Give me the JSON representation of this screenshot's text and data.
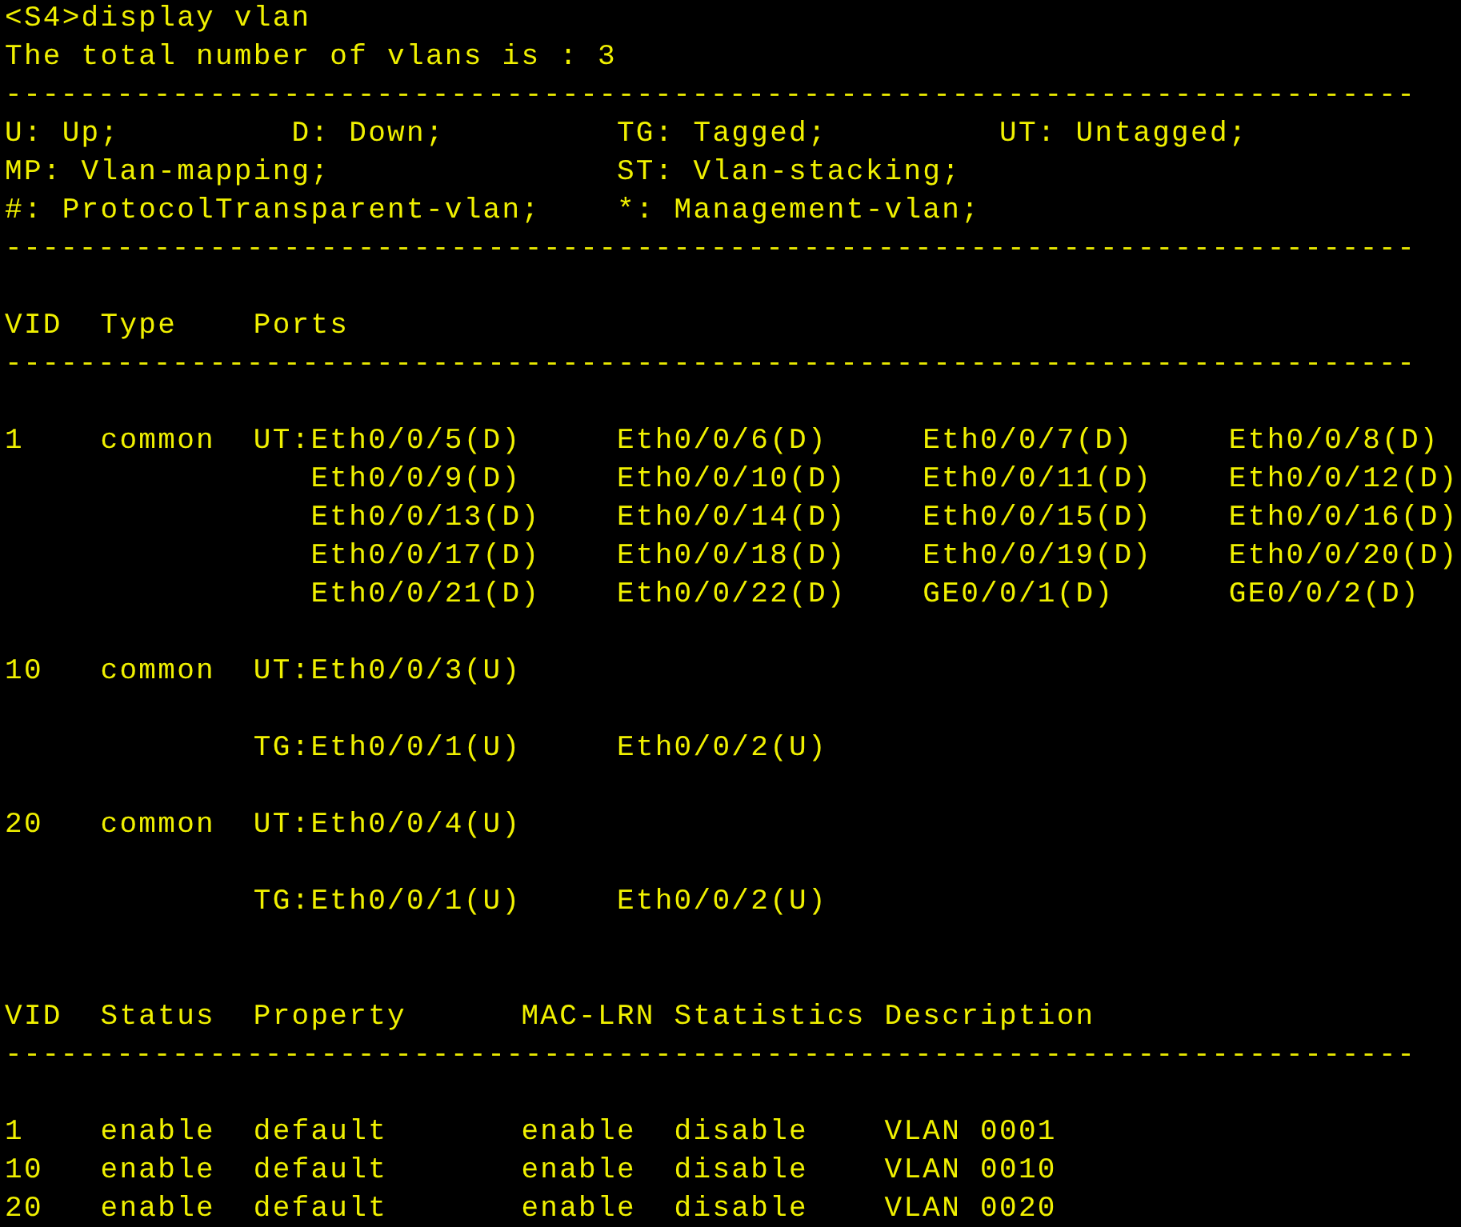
{
  "terminal": {
    "lines": [
      {
        "kind": "text",
        "text": "<S4>display vlan"
      },
      {
        "kind": "text",
        "text": "The total number of vlans is : 3"
      },
      {
        "kind": "rule",
        "text": "----------------------------------------------------------------------------"
      },
      {
        "kind": "text",
        "text": "U: Up;         D: Down;         TG: Tagged;         UT: Untagged;"
      },
      {
        "kind": "text",
        "text": "MP: Vlan-mapping;               ST: Vlan-stacking;"
      },
      {
        "kind": "text",
        "text": "#: ProtocolTransparent-vlan;    *: Management-vlan;"
      },
      {
        "kind": "rule",
        "text": "----------------------------------------------------------------------------"
      },
      {
        "kind": "blank"
      },
      {
        "kind": "text",
        "text": "VID  Type    Ports"
      },
      {
        "kind": "rule",
        "text": "----------------------------------------------------------------------------"
      },
      {
        "kind": "blank"
      },
      {
        "kind": "text",
        "text": "1    common  UT:Eth0/0/5(D)     Eth0/0/6(D)     Eth0/0/7(D)     Eth0/0/8(D)"
      },
      {
        "kind": "text",
        "text": "                Eth0/0/9(D)     Eth0/0/10(D)    Eth0/0/11(D)    Eth0/0/12(D)"
      },
      {
        "kind": "text",
        "text": "                Eth0/0/13(D)    Eth0/0/14(D)    Eth0/0/15(D)    Eth0/0/16(D)"
      },
      {
        "kind": "text",
        "text": "                Eth0/0/17(D)    Eth0/0/18(D)    Eth0/0/19(D)    Eth0/0/20(D)"
      },
      {
        "kind": "text",
        "text": "                Eth0/0/21(D)    Eth0/0/22(D)    GE0/0/1(D)      GE0/0/2(D)"
      },
      {
        "kind": "blank"
      },
      {
        "kind": "text",
        "text": "10   common  UT:Eth0/0/3(U)"
      },
      {
        "kind": "blank"
      },
      {
        "kind": "text",
        "text": "             TG:Eth0/0/1(U)     Eth0/0/2(U)"
      },
      {
        "kind": "blank"
      },
      {
        "kind": "text",
        "text": "20   common  UT:Eth0/0/4(U)"
      },
      {
        "kind": "blank"
      },
      {
        "kind": "text",
        "text": "             TG:Eth0/0/1(U)     Eth0/0/2(U)"
      },
      {
        "kind": "blank"
      },
      {
        "kind": "blank"
      },
      {
        "kind": "text",
        "text": "VID  Status  Property      MAC-LRN Statistics Description"
      },
      {
        "kind": "rule",
        "text": "----------------------------------------------------------------------------"
      },
      {
        "kind": "blank"
      },
      {
        "kind": "text",
        "text": "1    enable  default       enable  disable    VLAN 0001"
      },
      {
        "kind": "text",
        "text": "10   enable  default       enable  disable    VLAN 0010"
      },
      {
        "kind": "text",
        "text": "20   enable  default       enable  disable    VLAN 0020"
      }
    ]
  }
}
